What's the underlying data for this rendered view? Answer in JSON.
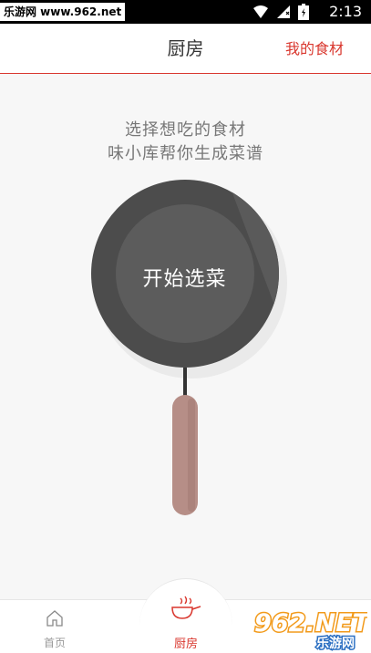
{
  "status_bar": {
    "watermark": "乐游网 www.962.net",
    "time": "2:13",
    "icons": [
      "wifi-icon",
      "signal-icon",
      "battery-icon"
    ]
  },
  "header": {
    "title": "厨房",
    "my_ingredients": "我的食材"
  },
  "intro": {
    "line1": "选择想吃的食材",
    "line2": "味小库帮你生成菜谱"
  },
  "pan": {
    "button_label": "开始选菜"
  },
  "tabbar": {
    "home_label": "首页",
    "kitchen_label": "厨房"
  },
  "logo": {
    "text": "962.NET",
    "subtext": "乐游网"
  },
  "colors": {
    "accent": "#d9372e",
    "pan_dark": "#4c4c4c",
    "pan_inner": "#5c5c5c",
    "handle": "#b68e87"
  }
}
